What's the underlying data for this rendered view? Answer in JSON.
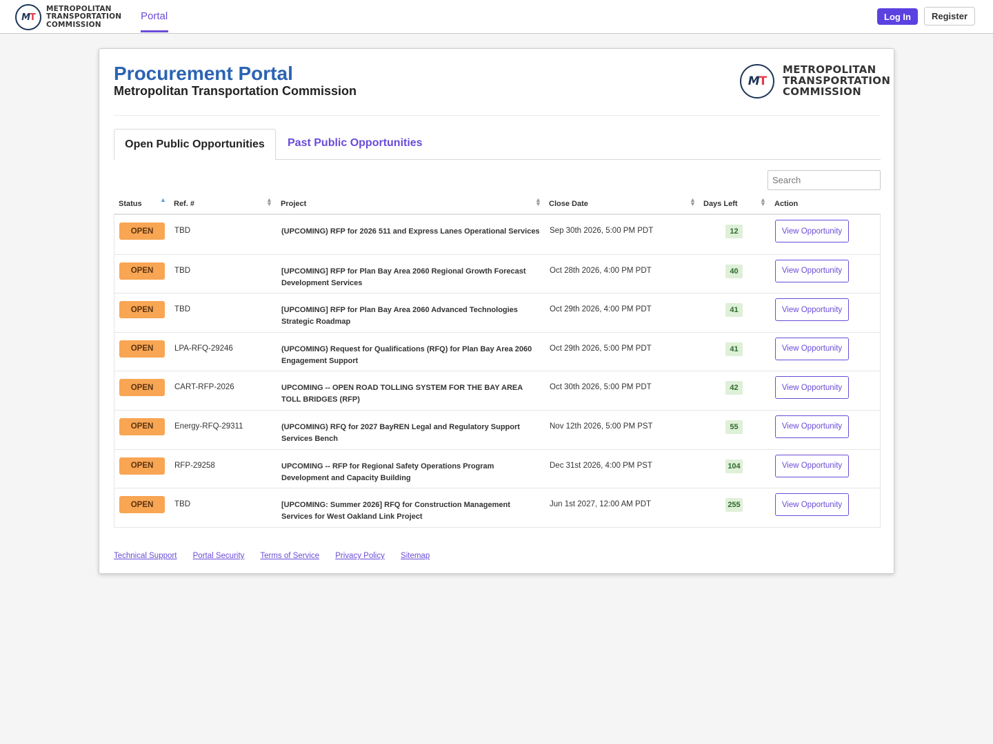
{
  "nav": {
    "logo_text_lines": [
      "METROPOLITAN",
      "TRANSPORTATION",
      "COMMISSION"
    ],
    "portal_label": "Portal",
    "login_label": "Log In",
    "register_label": "Register"
  },
  "header": {
    "title": "Procurement Portal",
    "subtitle": "Metropolitan Transportation Commission",
    "logo_text_lines": [
      "METROPOLITAN",
      "TRANSPORTATION",
      "COMMISSION"
    ]
  },
  "tabs": {
    "open": "Open Public Opportunities",
    "past": "Past Public Opportunities"
  },
  "search": {
    "placeholder": "Search"
  },
  "table": {
    "columns": [
      "Status",
      "Ref. #",
      "Project",
      "Close Date",
      "Days Left",
      "Action"
    ],
    "rows": [
      {
        "status": "OPEN",
        "ref": "TBD",
        "project": "(UPCOMING) RFP for 2026 511 and Express Lanes Operational Services",
        "close_date": "Sep 30th 2026, 5:00 PM PDT",
        "days_left": "12",
        "action": "View Opportunity"
      },
      {
        "status": "OPEN",
        "ref": "TBD",
        "project": "[UPCOMING] RFP for Plan Bay Area 2060 Regional Growth Forecast Development Services",
        "close_date": "Oct 28th 2026, 4:00 PM PDT",
        "days_left": "40",
        "action": "View Opportunity"
      },
      {
        "status": "OPEN",
        "ref": "TBD",
        "project": "[UPCOMING] RFP for Plan Bay Area 2060 Advanced Technologies Strategic Roadmap",
        "close_date": "Oct 29th 2026, 4:00 PM PDT",
        "days_left": "41",
        "action": "View Opportunity"
      },
      {
        "status": "OPEN",
        "ref": "LPA-RFQ-29246",
        "project": "(UPCOMING) Request for Qualifications (RFQ) for Plan Bay Area 2060 Engagement Support",
        "close_date": "Oct 29th 2026, 5:00 PM PDT",
        "days_left": "41",
        "action": "View Opportunity"
      },
      {
        "status": "OPEN",
        "ref": "CART-RFP-2026",
        "project": "UPCOMING -- OPEN ROAD TOLLING SYSTEM FOR THE BAY AREA TOLL BRIDGES (RFP)",
        "close_date": "Oct 30th 2026, 5:00 PM PDT",
        "days_left": "42",
        "action": "View Opportunity"
      },
      {
        "status": "OPEN",
        "ref": "Energy-RFQ-29311",
        "project": "(UPCOMING) RFQ for 2027 BayREN Legal and Regulatory Support Services Bench",
        "close_date": "Nov 12th 2026, 5:00 PM PST",
        "days_left": "55",
        "action": "View Opportunity"
      },
      {
        "status": "OPEN",
        "ref": "RFP-29258",
        "project": "UPCOMING -- RFP for Regional Safety Operations Program Development and Capacity Building",
        "close_date": "Dec 31st 2026, 4:00 PM PST",
        "days_left": "104",
        "action": "View Opportunity"
      },
      {
        "status": "OPEN",
        "ref": "TBD",
        "project": "[UPCOMING: Summer 2026] RFQ for Construction Management Services for West Oakland Link Project",
        "close_date": "Jun 1st 2027, 12:00 AM PDT",
        "days_left": "255",
        "action": "View Opportunity"
      }
    ]
  },
  "footer": {
    "links": [
      "Technical Support",
      "Portal Security",
      "Terms of Service",
      "Privacy Policy",
      "Sitemap"
    ]
  },
  "colors": {
    "accent": "#6a4bd8",
    "title_blue": "#2b63b3",
    "open_badge": "#f8a554",
    "days_badge": "#dff0d8"
  }
}
